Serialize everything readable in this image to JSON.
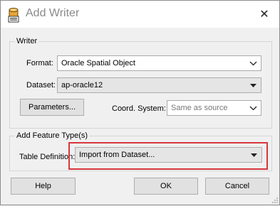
{
  "window": {
    "title": "Add Writer",
    "close_glyph": "✕",
    "icon": "database-writer-icon"
  },
  "writer_group": {
    "label": "Writer",
    "format": {
      "label": "Format:",
      "value": "Oracle Spatial Object"
    },
    "dataset": {
      "label": "Dataset:",
      "value": "ap-oracle12"
    },
    "parameters_button": "Parameters...",
    "coord_system": {
      "label": "Coord. System:",
      "value": "Same as source"
    }
  },
  "feature_group": {
    "label": "Add Feature Type(s)",
    "table_definition": {
      "label": "Table Definition:",
      "value": "Import from Dataset..."
    },
    "highlight_color": "#d9363e"
  },
  "buttons": {
    "help": "Help",
    "ok": "OK",
    "cancel": "Cancel"
  }
}
